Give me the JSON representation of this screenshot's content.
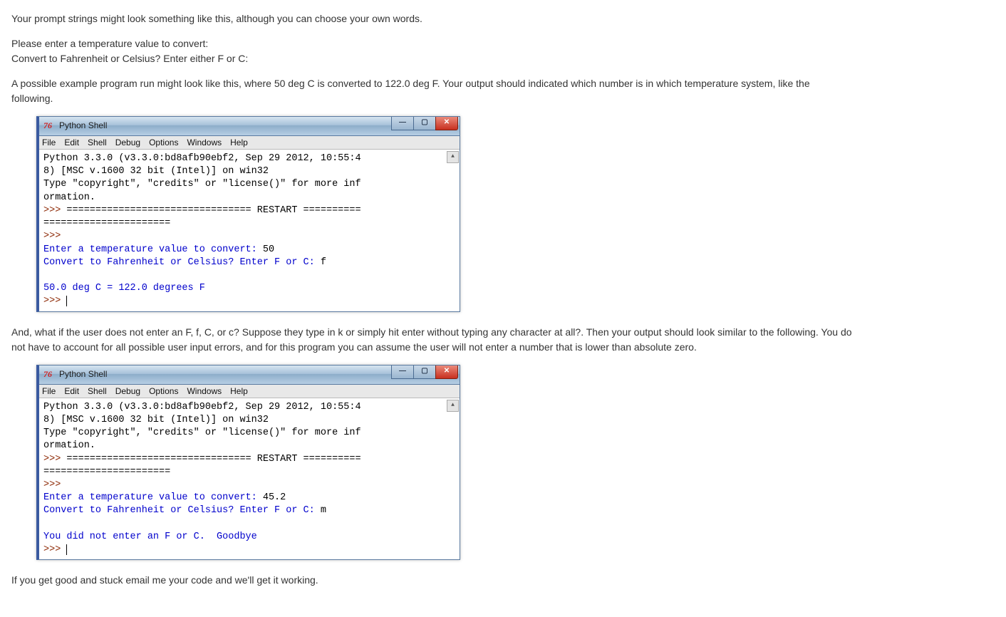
{
  "para": {
    "intro": "Your prompt strings might look something like this, although you can choose your own words.",
    "prompt1": "Please enter a temperature value to convert:",
    "prompt2": "Convert to Fahrenheit or Celsius? Enter either F or C:",
    "example": "A possible example program run might look like this, where 50 deg C is converted to 122.0 deg F. Your output should indicated which number is in which temperature system, like the following.",
    "invalid": "And, what if the user does not enter an F, f, C, or c? Suppose they type in k or simply hit enter without typing any character at all?. Then your output should look similar to the following. You do not have to account for all possible user input errors, and for this program you can assume the user will not enter a number that is lower than absolute zero.",
    "outro": "If you get good and stuck email me your code and we'll get it working."
  },
  "window": {
    "logo": "76",
    "title": "Python Shell",
    "menu": [
      "File",
      "Edit",
      "Shell",
      "Debug",
      "Options",
      "Windows",
      "Help"
    ],
    "min": "—",
    "max": "▢",
    "close": "✕",
    "scroll_up": "▲"
  },
  "shell1": {
    "l1": "Python 3.3.0 (v3.3.0:bd8afb90ebf2, Sep 29 2012, 10:55:4",
    "l2": "8) [MSC v.1600 32 bit (Intel)] on win32",
    "l3": "Type \"copyright\", \"credits\" or \"license()\" for more inf",
    "l4": "ormation.",
    "l5a": ">>> ",
    "l5b": "================================ RESTART ==========",
    "l6": "======================",
    "l7": ">>> ",
    "l8a": "Enter a temperature value to convert: ",
    "l8b": "50",
    "l9a": "Convert to Fahrenheit or Celsius? Enter F or C: ",
    "l9b": "f",
    "l10": "",
    "l11": "50.0 deg C = 122.0 degrees F",
    "l12": ">>> "
  },
  "shell2": {
    "l1": "Python 3.3.0 (v3.3.0:bd8afb90ebf2, Sep 29 2012, 10:55:4",
    "l2": "8) [MSC v.1600 32 bit (Intel)] on win32",
    "l3": "Type \"copyright\", \"credits\" or \"license()\" for more inf",
    "l4": "ormation.",
    "l5a": ">>> ",
    "l5b": "================================ RESTART ==========",
    "l6": "======================",
    "l7": ">>> ",
    "l8a": "Enter a temperature value to convert: ",
    "l8b": "45.2",
    "l9a": "Convert to Fahrenheit or Celsius? Enter F or C: ",
    "l9b": "m",
    "l10": "",
    "l11": "You did not enter an F or C.  Goodbye",
    "l12": ">>> "
  }
}
